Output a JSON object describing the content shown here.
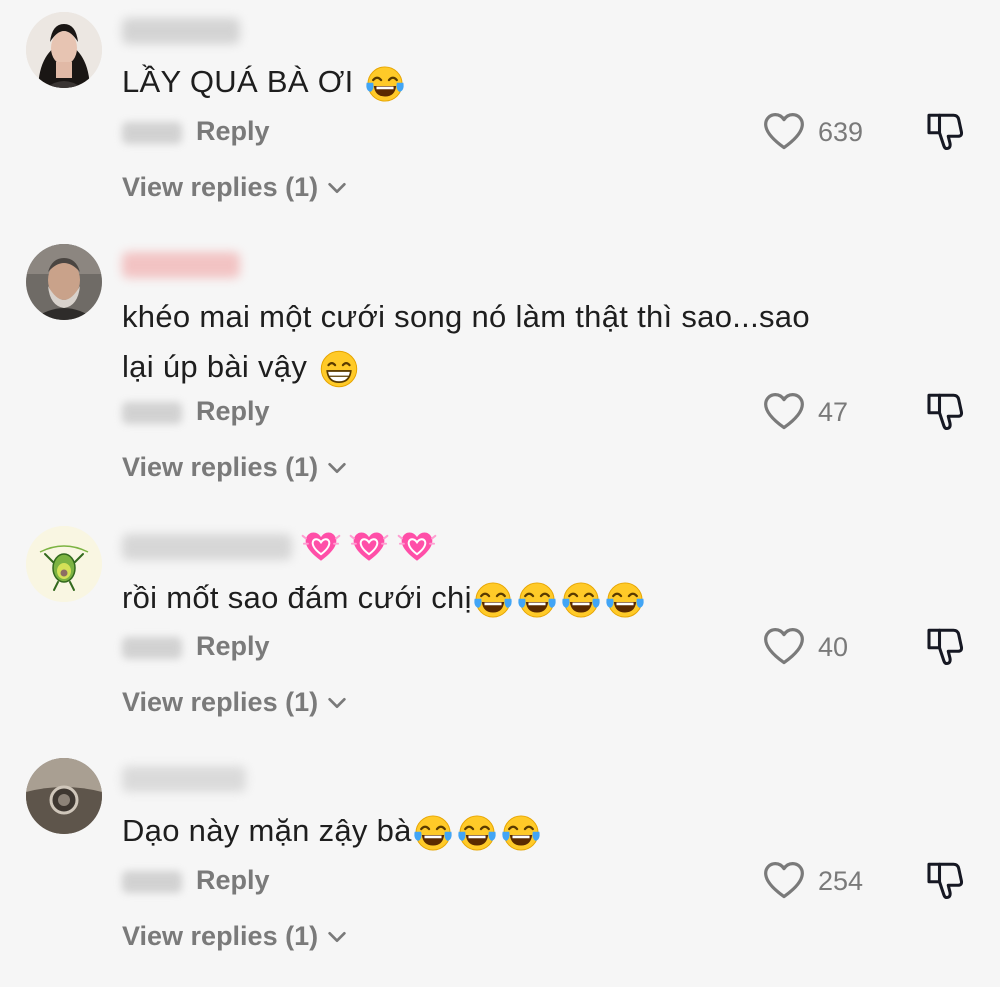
{
  "comments": [
    {
      "text": "LẦY QUÁ BÀ ƠI",
      "emojis": [
        "laughing-tears"
      ],
      "reply_label": "Reply",
      "likes": "639",
      "view_replies": "View replies (1)"
    },
    {
      "text_line1": "khéo mai một cưới song nó làm thật thì sao...sao",
      "text_line2": "lại úp bài vậy",
      "emojis": [
        "grinning"
      ],
      "reply_label": "Reply",
      "likes": "47",
      "view_replies": "View replies (1)"
    },
    {
      "text": "rồi mốt sao đám cưới chị",
      "username_emojis": [
        "heart",
        "heart",
        "heart"
      ],
      "emojis": [
        "laughing-tears",
        "laughing-tears",
        "laughing-tears",
        "laughing-tears"
      ],
      "reply_label": "Reply",
      "likes": "40",
      "view_replies": "View replies (1)"
    },
    {
      "text": "Dạo này mặn zậy bà",
      "emojis": [
        "laughing-tears",
        "laughing-tears",
        "laughing-tears"
      ],
      "reply_label": "Reply",
      "likes": "254",
      "view_replies": "View replies (1)"
    }
  ],
  "colors": {
    "background": "#f6f6f6",
    "muted": "#7a7a7a",
    "heart_emoji": "#ff4fa8"
  }
}
